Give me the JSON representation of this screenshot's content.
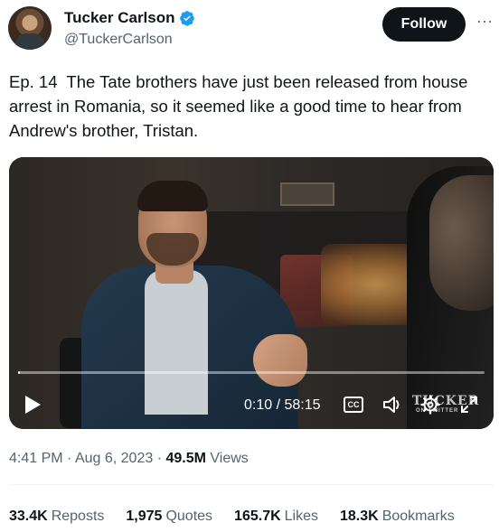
{
  "author": {
    "name": "Tucker Carlson",
    "handle": "@TuckerCarlson",
    "avatar_icon": "avatar",
    "verified_icon": "verified-badge-icon",
    "verified_color": "#1d9bf0"
  },
  "actions": {
    "follow_label": "Follow",
    "more_icon": "more-icon"
  },
  "tweet": {
    "text": "Ep. 14  The Tate brothers have just been released from house arrest in Romania, so it seemed like a good time to hear from Andrew's brother, Tristan."
  },
  "video": {
    "time_display": "0:10 / 58:15",
    "progress_fraction": 0.003,
    "cc_label": "CC",
    "watermark_main": "TUCKER",
    "watermark_sub": "ON TWITTER",
    "controls": [
      "play-icon",
      "closed-captions-icon",
      "volume-icon",
      "settings-icon",
      "fullscreen-icon"
    ]
  },
  "meta": {
    "time": "4:41 PM",
    "separator": "·",
    "date": "Aug 6, 2023",
    "views_count": "49.5M",
    "views_label": "Views"
  },
  "stats": [
    {
      "count": "33.4K",
      "label": "Reposts"
    },
    {
      "count": "1,975",
      "label": "Quotes"
    },
    {
      "count": "165.7K",
      "label": "Likes"
    },
    {
      "count": "18.3K",
      "label": "Bookmarks"
    }
  ]
}
